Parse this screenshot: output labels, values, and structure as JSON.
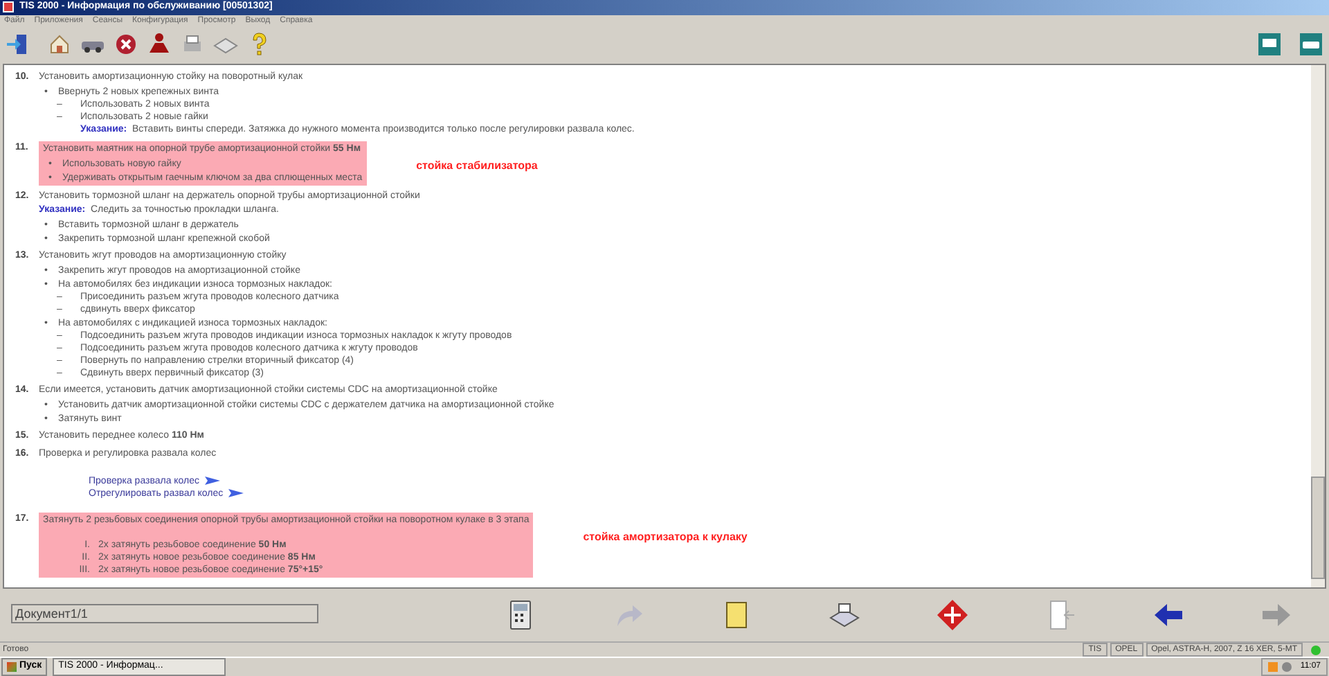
{
  "window": {
    "title": "TIS 2000 - Информация по обслуживанию [00501302]"
  },
  "menu": [
    "Файл",
    "Приложения",
    "Сеансы",
    "Конфигурация",
    "Просмотр",
    "Выход",
    "Справка"
  ],
  "steps": [
    {
      "number": "10.",
      "text": "Установить амортизационную стойку на поворотный кулак",
      "highlighted": false,
      "items": [
        {
          "kind": "bullet",
          "marker": "•",
          "text": "Ввернуть 2 новых крепежных винта",
          "children": [
            {
              "kind": "dash",
              "marker": "–",
              "text": "Использовать 2 новых винта"
            },
            {
              "kind": "dash",
              "marker": "–",
              "text": "Использовать 2 новые гайки",
              "note": {
                "label": "Указание:",
                "text": "Вставить винты спереди. Затяжка до нужного момента производится только после регулировки развала колес."
              }
            }
          ]
        }
      ]
    },
    {
      "number": "11.",
      "text": "Установить маятник на опорной трубе амортизационной стойки **55 Нм**",
      "highlighted": true,
      "annotation": "стойка стабилизатора",
      "items": [
        {
          "kind": "bullet",
          "marker": "•",
          "text": "Использовать новую гайку"
        },
        {
          "kind": "bullet",
          "marker": "•",
          "text": "Удерживать открытым гаечным ключом за два сплющенных места"
        }
      ]
    },
    {
      "number": "12.",
      "text": "Установить тормозной шланг на держатель опорной трубы амортизационной стойки",
      "highlighted": false,
      "note": {
        "label": "Указание:",
        "text": "Следить за точностью прокладки шланга."
      },
      "items": [
        {
          "kind": "bullet",
          "marker": "•",
          "text": "Вставить тормозной шланг в держатель"
        },
        {
          "kind": "bullet",
          "marker": "•",
          "text": "Закрепить тормозной шланг крепежной скобой"
        }
      ]
    },
    {
      "number": "13.",
      "text": "Установить жгут проводов на амортизационную стойку",
      "highlighted": false,
      "items": [
        {
          "kind": "bullet",
          "marker": "•",
          "text": "Закрепить жгут проводов на амортизационной стойке"
        },
        {
          "kind": "bullet",
          "marker": "•",
          "text": "На автомобилях без индикации износа тормозных накладок:",
          "children": [
            {
              "kind": "dash",
              "marker": "–",
              "text": "Присоединить разъем жгута проводов колесного датчика"
            },
            {
              "kind": "dash",
              "marker": "–",
              "text": "сдвинуть вверх фиксатор"
            }
          ]
        },
        {
          "kind": "bullet",
          "marker": "•",
          "text": "На автомобилях с индикацией износа тормозных накладок:",
          "children": [
            {
              "kind": "dash",
              "marker": "–",
              "text": "Подсоединить разъем жгута проводов индикации износа тормозных накладок к жгуту проводов"
            },
            {
              "kind": "dash",
              "marker": "–",
              "text": "Подсоединить разъем жгута проводов колесного датчика к жгуту проводов"
            },
            {
              "kind": "dash",
              "marker": "–",
              "text": "Повернуть по направлению стрелки вторичный фиксатор (4)"
            },
            {
              "kind": "dash",
              "marker": "–",
              "text": "Сдвинуть вверх первичный фиксатор (3)"
            }
          ]
        }
      ]
    },
    {
      "number": "14.",
      "text": "Если имеется, установить датчик амортизационной стойки системы CDC на амортизационной стойке",
      "highlighted": false,
      "items": [
        {
          "kind": "bullet",
          "marker": "•",
          "text": "Установить датчик амортизационной стойки системы CDC с держателем датчика на амортизационной стойке"
        },
        {
          "kind": "bullet",
          "marker": "•",
          "text": "Затянуть винт"
        }
      ]
    },
    {
      "number": "15.",
      "text": "Установить переднее колесо **110 Нм**",
      "highlighted": false
    },
    {
      "number": "16.",
      "text": "Проверка и регулировка развала колес",
      "highlighted": false,
      "items": [
        {
          "kind": "link",
          "text": "Проверка развала колес"
        },
        {
          "kind": "link",
          "text": "Отрегулировать развал колес"
        }
      ]
    },
    {
      "number": "17.",
      "text": "Затянуть 2 резьбовых соединения опорной трубы амортизационной стойки на поворотном кулаке в 3 этапа",
      "highlighted": true,
      "annotation": "стойка амортизатора к кулаку",
      "items": [
        {
          "kind": "roman",
          "marker": "I.",
          "text": "2х затянуть резьбовое соединение **50 Нм**"
        },
        {
          "kind": "roman",
          "marker": "II.",
          "text": "2х затянуть новое резьбовое соединение **85 Нм**"
        },
        {
          "kind": "roman",
          "marker": "III.",
          "text": "2х затянуть новое резьбовое соединение **75°+15°**"
        }
      ]
    }
  ],
  "document_field": {
    "value": "Документ1/1"
  },
  "status_bar": [
    "Готово",
    "TIS",
    "OPEL",
    "Opel, ASTRA-H, 2007, Z 16 XER, 5-MT"
  ],
  "taskbar": {
    "start": "Пуск",
    "task": "TIS 2000 - Информац...",
    "clock": "11:07"
  }
}
